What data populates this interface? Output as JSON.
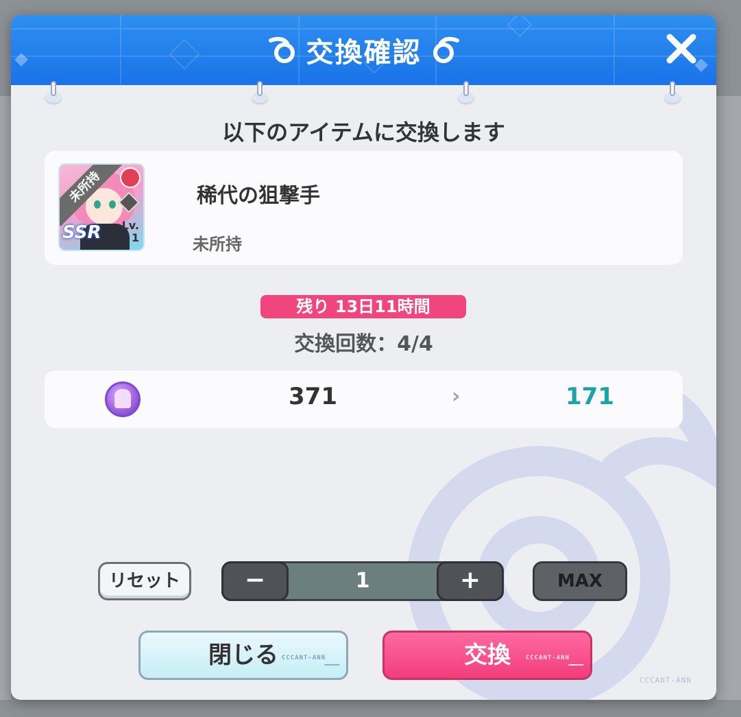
{
  "dialog": {
    "title": "交換確認",
    "subtitle": "以下のアイテムに交換します",
    "item": {
      "name": "稀代の狙撃手",
      "status": "未所持",
      "thumb_banner": "未所持",
      "rarity": "SSR",
      "level": "Lv.\n1"
    },
    "remaining": "残り 13日11時間",
    "exchange_count": "交換回数：4/4",
    "cost": {
      "currency_icon": "purple-medal-icon",
      "before": "371",
      "arrow": "›",
      "after": "171"
    },
    "reset_label": "リセット",
    "stepper": {
      "minus": "−",
      "value": "1",
      "plus": "+"
    },
    "max_label": "MAX",
    "close_label": "閉じる",
    "exchange_label": "交換",
    "button_tag": "CCCANT-ANN",
    "brand_mark": "CCCANT-ANN"
  },
  "colors": {
    "header": "#1a73e8",
    "remaining_badge": "#f0457d",
    "cost_after": "#1aa3a8",
    "exchange_button": "#f23d7c"
  }
}
